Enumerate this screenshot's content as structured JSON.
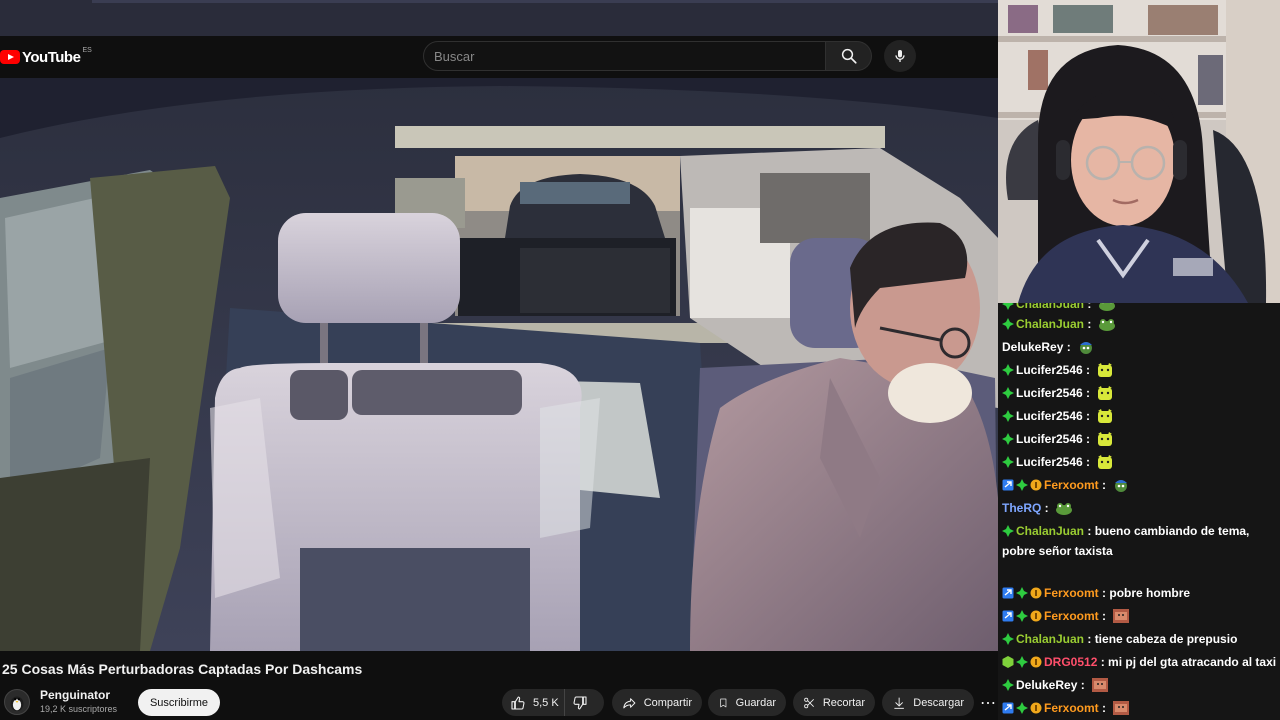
{
  "header": {
    "brand": "YouTube",
    "country_code": "ES",
    "search_placeholder": "Buscar"
  },
  "video": {
    "title": "25 Cosas Más Perturbadoras Captadas Por Dashcams",
    "channel_name": "Penguinator",
    "subscribers": "19,2 K suscriptores",
    "subscribe_label": "Suscribirme",
    "likes": "5,5 K",
    "share_label": "Compartir",
    "save_label": "Guardar",
    "clip_label": "Recortar",
    "download_label": "Descargar",
    "more_label": "⋯"
  },
  "colors": {
    "accent": "#ff0000",
    "chat_green": "#9acd32",
    "chat_orange": "#ff9b1f",
    "chat_red": "#ff4f6b",
    "chat_blue": "#7ea6ff"
  },
  "chat": {
    "messages": [
      {
        "user": "ChalanJuan",
        "text": "",
        "color": "#9acd32",
        "badges": [
          "gem-green"
        ],
        "emote": "frog"
      },
      {
        "user": "ChalanJuan",
        "text": "",
        "color": "#9acd32",
        "badges": [
          "gem-green"
        ],
        "emote": "frog"
      },
      {
        "user": "DelukeRey",
        "text": "",
        "color": "#ffffff",
        "badges": [],
        "emote": "pepe-blue"
      },
      {
        "user": "Lucifer2546",
        "text": "",
        "color": "#ffffff",
        "badges": [
          "gem-green"
        ],
        "emote": "cat-yellow"
      },
      {
        "user": "Lucifer2546",
        "text": "",
        "color": "#ffffff",
        "badges": [
          "gem-green"
        ],
        "emote": "cat-yellow"
      },
      {
        "user": "Lucifer2546",
        "text": "",
        "color": "#ffffff",
        "badges": [
          "gem-green"
        ],
        "emote": "cat-yellow"
      },
      {
        "user": "Lucifer2546",
        "text": "",
        "color": "#ffffff",
        "badges": [
          "gem-green"
        ],
        "emote": "cat-yellow"
      },
      {
        "user": "Lucifer2546",
        "text": "",
        "color": "#ffffff",
        "badges": [
          "gem-green"
        ],
        "emote": "cat-yellow"
      },
      {
        "user": "Ferxoomt",
        "text": "",
        "color": "#ff9b1f",
        "badges": [
          "prime-blue",
          "gem-green",
          "coin-orange"
        ],
        "emote": "pepe-blue"
      },
      {
        "user": "TheRQ",
        "text": "",
        "color": "#7ea6ff",
        "badges": [],
        "emote": "frog"
      },
      {
        "user": "ChalanJuan",
        "text": "bueno cambiando de tema, pobre señor taxista",
        "color": "#9acd32",
        "badges": [
          "gem-green"
        ],
        "emote": ""
      },
      {
        "user": "Ferxoomt",
        "text": "pobre hombre",
        "color": "#ff9b1f",
        "badges": [
          "prime-blue",
          "gem-green",
          "coin-orange"
        ],
        "emote": ""
      },
      {
        "user": "Ferxoomt",
        "text": "",
        "color": "#ff9b1f",
        "badges": [
          "prime-blue",
          "gem-green",
          "coin-orange"
        ],
        "emote": "face-red"
      },
      {
        "user": "ChalanJuan",
        "text": "tiene cabeza de prepusio",
        "color": "#9acd32",
        "badges": [
          "gem-green"
        ],
        "emote": ""
      },
      {
        "user": "DRG0512",
        "text": "mi pj del gta atracando al taxi",
        "color": "#ff4f6b",
        "badges": [
          "cube-green",
          "gem-green",
          "coin-orange"
        ],
        "emote": ""
      },
      {
        "user": "DelukeRey",
        "text": "",
        "color": "#ffffff",
        "badges": [
          "gem-green"
        ],
        "emote": "face-red"
      },
      {
        "user": "Ferxoomt",
        "text": "",
        "color": "#ff9b1f",
        "badges": [
          "prime-blue",
          "gem-green",
          "coin-orange"
        ],
        "emote": "face-red"
      }
    ]
  }
}
